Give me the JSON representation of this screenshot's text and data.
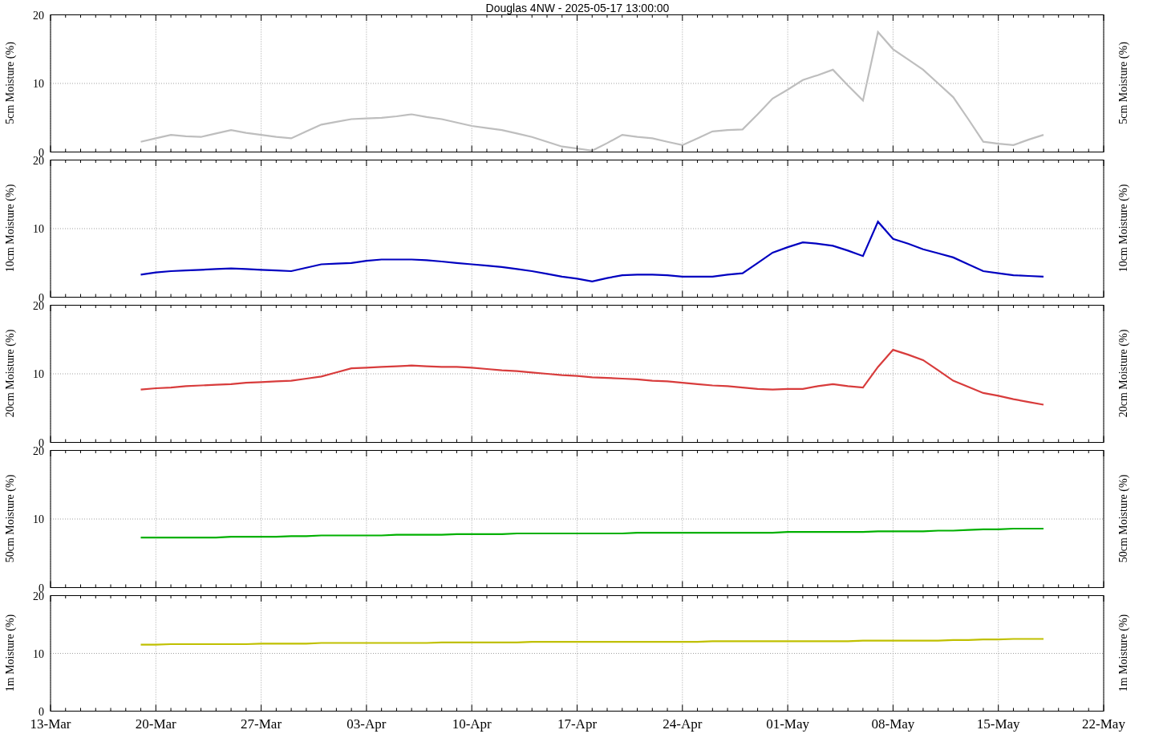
{
  "title": "Douglas 4NW - 2025-05-17 13:00:00",
  "panels": [
    {
      "right_label": "5cm Moisture (%)",
      "chart_data": {
        "type": "line",
        "grid": true,
        "ylabel": "5cm Moisture (%)",
        "series": [
          {
            "color": "#bebebe",
            "values": [
              null,
              null,
              null,
              null,
              null,
              null,
              1.5,
              2.0,
              2.5,
              2.3,
              2.2,
              2.7,
              3.2,
              2.8,
              2.5,
              2.2,
              2.0,
              3.0,
              4.0,
              4.4,
              4.8,
              4.9,
              5.0,
              5.2,
              5.5,
              5.1,
              4.8,
              4.3,
              3.8,
              3.5,
              3.2,
              2.7,
              2.2,
              1.5,
              0.8,
              0.5,
              0.2,
              1.3,
              2.5,
              2.2,
              2.0,
              1.5,
              1.0,
              2.0,
              3.0,
              3.2,
              3.3,
              5.5,
              7.8,
              9.1,
              10.5,
              11.2,
              12.0,
              9.7,
              7.5,
              17.5,
              15.0,
              13.5,
              12.0,
              10.0,
              8.0,
              4.8,
              1.5,
              1.2,
              1.0,
              1.8,
              2.5,
              null,
              null,
              null,
              null
            ]
          }
        ],
        "ylim": [
          0,
          20
        ],
        "yticks": [
          {
            "value": 0,
            "label": "0"
          },
          {
            "value": 10,
            "label": "10"
          },
          {
            "value": 20,
            "label": "20"
          }
        ]
      }
    },
    {
      "right_label": "10cm Moisture (%)",
      "chart_data": {
        "type": "line",
        "grid": true,
        "ylabel": "10cm Moisture (%)",
        "series": [
          {
            "color": "#0000c0",
            "values": [
              null,
              null,
              null,
              null,
              null,
              null,
              3.3,
              3.6,
              3.8,
              3.9,
              4.0,
              4.1,
              4.2,
              4.1,
              4.0,
              3.9,
              3.8,
              4.3,
              4.8,
              4.9,
              5.0,
              5.3,
              5.5,
              5.5,
              5.5,
              5.4,
              5.2,
              5.0,
              4.8,
              4.6,
              4.4,
              4.1,
              3.8,
              3.4,
              3.0,
              2.7,
              2.3,
              2.8,
              3.2,
              3.3,
              3.3,
              3.2,
              3.0,
              3.0,
              3.0,
              3.3,
              3.5,
              5.0,
              6.5,
              7.3,
              8.0,
              7.8,
              7.5,
              6.8,
              6.0,
              11.0,
              8.5,
              7.8,
              7.0,
              6.4,
              5.8,
              4.8,
              3.8,
              3.5,
              3.2,
              3.1,
              3.0,
              null,
              null,
              null,
              null
            ]
          }
        ],
        "ylim": [
          0,
          20
        ],
        "yticks": [
          {
            "value": 0,
            "label": "0"
          },
          {
            "value": 10,
            "label": "10"
          },
          {
            "value": 20,
            "label": "20"
          }
        ]
      }
    },
    {
      "right_label": "20cm Moisture (%)",
      "chart_data": {
        "type": "line",
        "grid": true,
        "ylabel": "20cm Moisture (%)",
        "series": [
          {
            "color": "#d83c3c",
            "values": [
              null,
              null,
              null,
              null,
              null,
              null,
              7.7,
              7.9,
              8.0,
              8.2,
              8.3,
              8.4,
              8.5,
              8.7,
              8.8,
              8.9,
              9.0,
              9.3,
              9.6,
              10.2,
              10.8,
              10.9,
              11.0,
              11.1,
              11.2,
              11.1,
              11.0,
              11.0,
              10.9,
              10.7,
              10.5,
              10.4,
              10.2,
              10.0,
              9.8,
              9.7,
              9.5,
              9.4,
              9.3,
              9.2,
              9.0,
              8.9,
              8.7,
              8.5,
              8.3,
              8.2,
              8.0,
              7.8,
              7.7,
              7.8,
              7.8,
              8.2,
              8.5,
              8.2,
              8.0,
              11.0,
              13.5,
              12.8,
              12.0,
              10.5,
              9.0,
              8.1,
              7.2,
              6.8,
              6.3,
              5.9,
              5.5,
              null,
              null,
              null,
              null
            ]
          }
        ],
        "ylim": [
          0,
          20
        ],
        "yticks": [
          {
            "value": 0,
            "label": "0"
          },
          {
            "value": 10,
            "label": "10"
          },
          {
            "value": 20,
            "label": "20"
          }
        ]
      }
    },
    {
      "right_label": "50cm Moisture (%)",
      "chart_data": {
        "type": "line",
        "grid": true,
        "ylabel": "50cm Moisture (%)",
        "series": [
          {
            "color": "#00b000",
            "values": [
              null,
              null,
              null,
              null,
              null,
              null,
              7.3,
              7.3,
              7.3,
              7.3,
              7.3,
              7.3,
              7.4,
              7.4,
              7.4,
              7.4,
              7.5,
              7.5,
              7.6,
              7.6,
              7.6,
              7.6,
              7.6,
              7.7,
              7.7,
              7.7,
              7.7,
              7.8,
              7.8,
              7.8,
              7.8,
              7.9,
              7.9,
              7.9,
              7.9,
              7.9,
              7.9,
              7.9,
              7.9,
              8.0,
              8.0,
              8.0,
              8.0,
              8.0,
              8.0,
              8.0,
              8.0,
              8.0,
              8.0,
              8.1,
              8.1,
              8.1,
              8.1,
              8.1,
              8.1,
              8.2,
              8.2,
              8.2,
              8.2,
              8.3,
              8.3,
              8.4,
              8.5,
              8.5,
              8.6,
              8.6,
              8.6,
              null,
              null,
              null,
              null
            ]
          }
        ],
        "ylim": [
          0,
          20
        ],
        "yticks": [
          {
            "value": 0,
            "label": "0"
          },
          {
            "value": 10,
            "label": "10"
          },
          {
            "value": 20,
            "label": "20"
          }
        ]
      }
    },
    {
      "right_label": "1m Moisture (%)",
      "chart_data": {
        "type": "line",
        "grid": true,
        "ylabel": "1m Moisture (%)",
        "categories": [
          "13-Mar",
          null,
          null,
          null,
          null,
          null,
          null,
          "20-Mar",
          null,
          null,
          null,
          null,
          null,
          null,
          "27-Mar",
          null,
          null,
          null,
          null,
          null,
          null,
          "03-Apr",
          null,
          null,
          null,
          null,
          null,
          null,
          "10-Apr",
          null,
          null,
          null,
          null,
          null,
          null,
          "17-Apr",
          null,
          null,
          null,
          null,
          null,
          null,
          "24-Apr",
          null,
          null,
          null,
          null,
          null,
          null,
          "01-May",
          null,
          null,
          null,
          null,
          null,
          null,
          "08-May",
          null,
          null,
          null,
          null,
          null,
          null,
          "15-May",
          null,
          null,
          null,
          null,
          null,
          null,
          "22-May"
        ],
        "series": [
          {
            "color": "#c0c000",
            "values": [
              null,
              null,
              null,
              null,
              null,
              null,
              11.5,
              11.5,
              11.6,
              11.6,
              11.6,
              11.6,
              11.6,
              11.6,
              11.7,
              11.7,
              11.7,
              11.7,
              11.8,
              11.8,
              11.8,
              11.8,
              11.8,
              11.8,
              11.8,
              11.8,
              11.9,
              11.9,
              11.9,
              11.9,
              11.9,
              11.9,
              12.0,
              12.0,
              12.0,
              12.0,
              12.0,
              12.0,
              12.0,
              12.0,
              12.0,
              12.0,
              12.0,
              12.0,
              12.1,
              12.1,
              12.1,
              12.1,
              12.1,
              12.1,
              12.1,
              12.1,
              12.1,
              12.1,
              12.2,
              12.2,
              12.2,
              12.2,
              12.2,
              12.2,
              12.3,
              12.3,
              12.4,
              12.4,
              12.5,
              12.5,
              12.5,
              null,
              null,
              null,
              null
            ]
          }
        ],
        "ylim": [
          0,
          20
        ],
        "yticks": [
          {
            "value": 0,
            "label": "0"
          },
          {
            "value": 10,
            "label": "10"
          },
          {
            "value": 20,
            "label": "20"
          }
        ]
      }
    }
  ]
}
